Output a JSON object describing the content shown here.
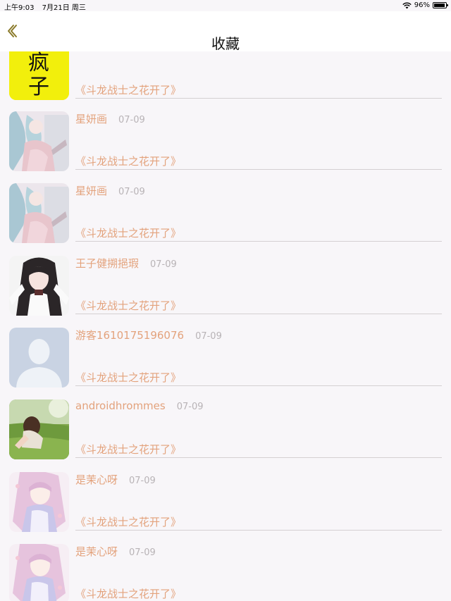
{
  "status_bar": {
    "time": "上午9:03",
    "date": "7月21日 周三",
    "battery_percent": "96%",
    "battery_level": 0.96
  },
  "nav": {
    "title": "收藏"
  },
  "list": {
    "items": [
      {
        "username": "",
        "date": "",
        "title": "《斗龙战士之花开了》",
        "avatar": "yellow-calligraphy-avatar",
        "avatar_text": "疯子"
      },
      {
        "username": "星妍画",
        "date": "07-09",
        "title": "《斗龙战士之花开了》",
        "avatar": "anime-girl-teal-hair-avatar"
      },
      {
        "username": "星妍画",
        "date": "07-09",
        "title": "《斗龙战士之花开了》",
        "avatar": "anime-girl-teal-hair-avatar"
      },
      {
        "username": "王子健搠挹瑕",
        "date": "07-09",
        "title": "《斗龙战士之花开了》",
        "avatar": "anime-girl-black-hair-avatar"
      },
      {
        "username": "游客1610175196076",
        "date": "07-09",
        "title": "《斗龙战士之花开了》",
        "avatar": "default-user-avatar"
      },
      {
        "username": "androidhrommes",
        "date": "07-09",
        "title": "《斗龙战士之花开了》",
        "avatar": "girl-in-grass-photo-avatar"
      },
      {
        "username": "是茉心呀",
        "date": "07-09",
        "title": "《斗龙战士之花开了》",
        "avatar": "anime-girl-pink-hair-avatar"
      },
      {
        "username": "是茉心呀",
        "date": "07-09",
        "title": "《斗龙战士之花开了》",
        "avatar": "anime-girl-pink-hair-avatar"
      }
    ]
  },
  "colors": {
    "accent": "#e3a27c",
    "date": "#b8b3b6",
    "background": "#f8f6f9",
    "back_icon": "#8a7a2a"
  }
}
